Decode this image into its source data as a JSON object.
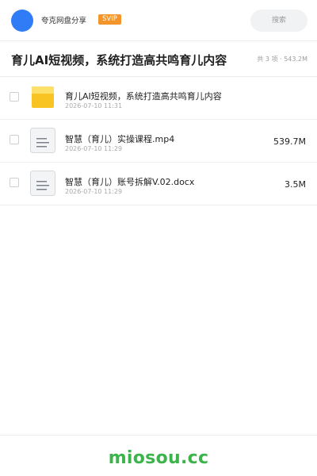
{
  "header": {
    "owner_name": "夸克网盘分享",
    "badge": "SVIP",
    "search_placeholder": "搜索",
    "avatar_color": "#2f7cf6",
    "badge_color": "#f4952b"
  },
  "share": {
    "title": "育儿AI短视频，系统打造高共鸣育儿内容",
    "summary": "共 3 项 · 543.2M"
  },
  "files": [
    {
      "name": "育儿AI短视频，系统打造高共鸣育儿内容",
      "date": "2026-07-10 11:31",
      "size": "",
      "icon": "folder-icon"
    },
    {
      "name": "智慧（育儿）实操课程.mp4",
      "date": "2026-07-10 11:29",
      "size": "539.7M",
      "icon": "document-icon"
    },
    {
      "name": "智慧（育儿）账号拆解V.02.docx",
      "date": "2026-07-10 11:29",
      "size": "3.5M",
      "icon": "document-icon"
    }
  ],
  "footer": {
    "brand": "miosou.cc",
    "brand_color": "#3cb44b"
  }
}
